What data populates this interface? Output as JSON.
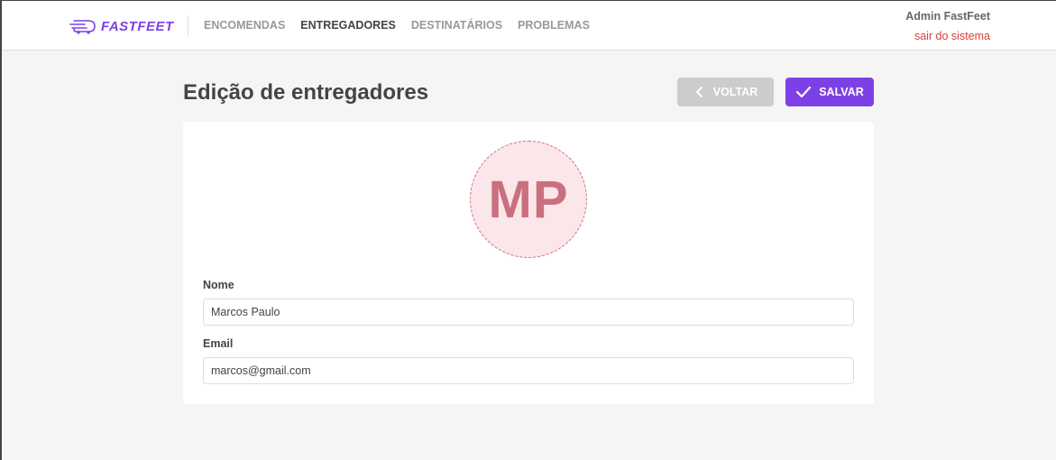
{
  "brand": {
    "name": "FASTFEET",
    "color": "#7d40e7"
  },
  "nav": {
    "items": [
      {
        "label": "ENCOMENDAS",
        "active": false
      },
      {
        "label": "ENTREGADORES",
        "active": true
      },
      {
        "label": "DESTINATÁRIOS",
        "active": false
      },
      {
        "label": "PROBLEMAS",
        "active": false
      }
    ]
  },
  "profile": {
    "name": "Admin FastFeet",
    "logout_label": "sair do sistema"
  },
  "page": {
    "title": "Edição de entregadores"
  },
  "actions": {
    "back_label": "VOLTAR",
    "back_icon": "chevron-left-icon",
    "save_label": "SALVAR",
    "save_icon": "check-icon"
  },
  "avatar": {
    "initials": "MP"
  },
  "form": {
    "name_label": "Nome",
    "name_value": "Marcos Paulo",
    "email_label": "Email",
    "email_value": "marcos@gmail.com"
  }
}
